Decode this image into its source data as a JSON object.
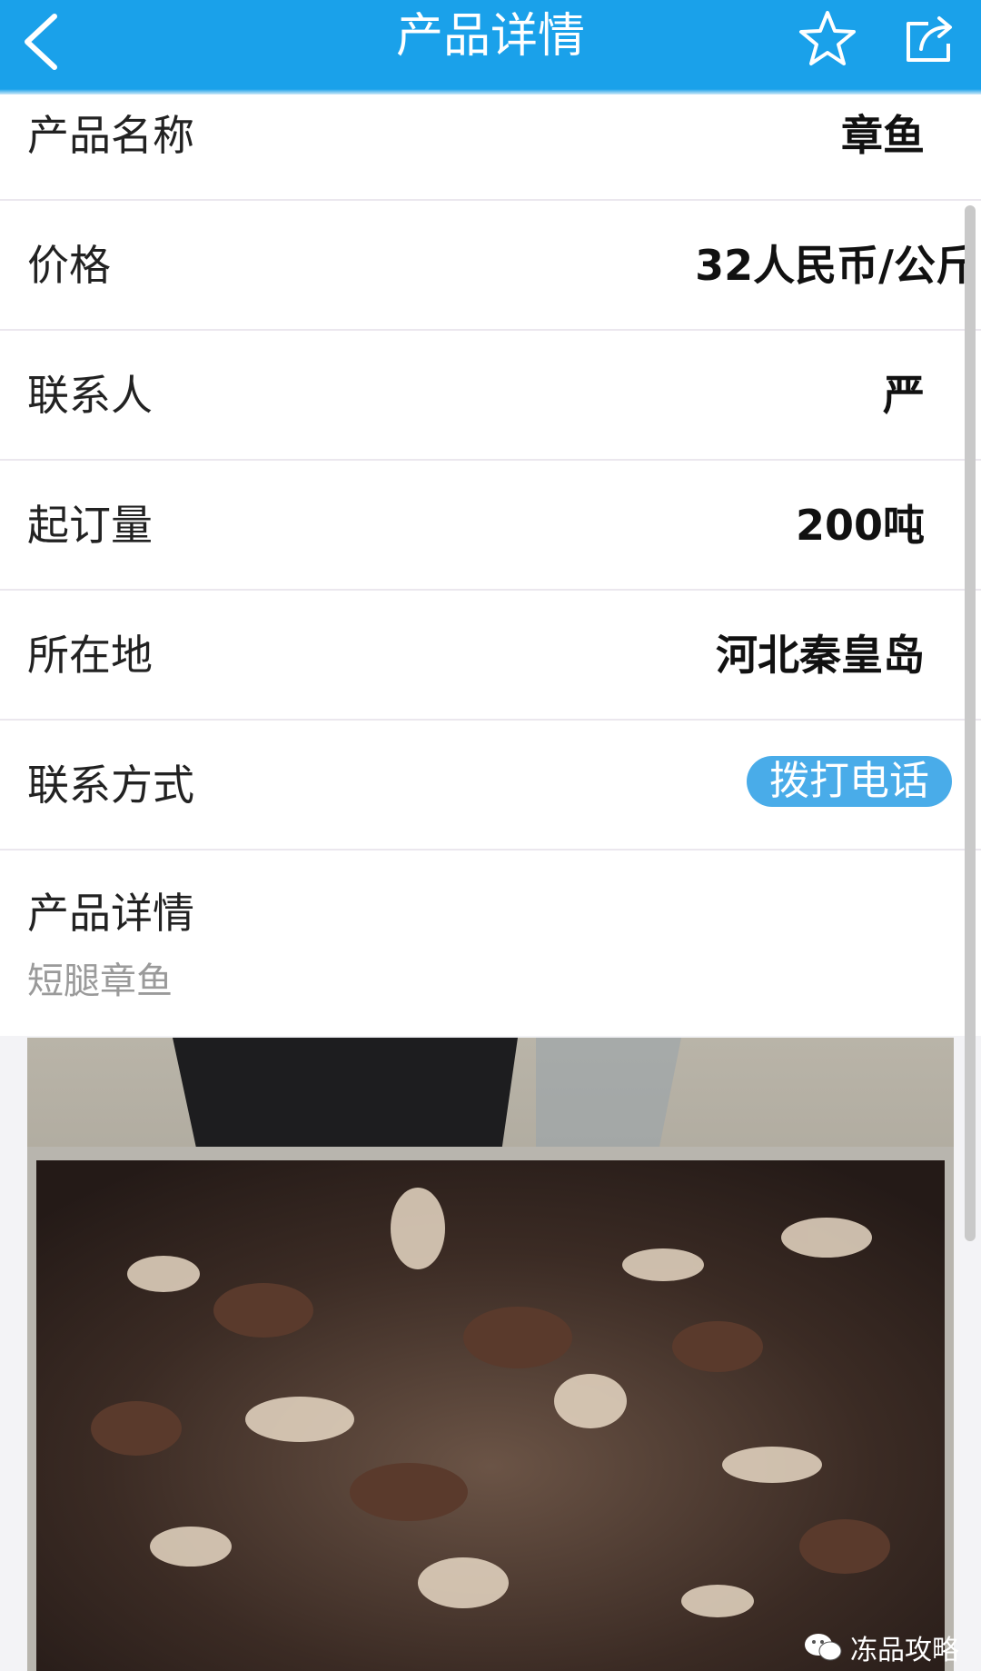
{
  "header": {
    "title": "产品详情",
    "bg_color": "#1aa1ea"
  },
  "fields": [
    {
      "label": "产品名称",
      "value": "章鱼"
    },
    {
      "label": "价格",
      "value": "32人民币/公斤"
    },
    {
      "label": "联系人",
      "value": "严"
    },
    {
      "label": "起订量",
      "value": "200吨"
    },
    {
      "label": "所在地",
      "value": "河北秦皇岛"
    },
    {
      "label": "联系方式",
      "button": "拨打电话"
    }
  ],
  "detail": {
    "label": "产品详情",
    "description": "短腿章鱼"
  },
  "watermark": {
    "text": "冻品攻略"
  },
  "colors": {
    "accent": "#1aa1ea",
    "call_button": "#49ace9",
    "muted_text": "#9a9a9a"
  }
}
